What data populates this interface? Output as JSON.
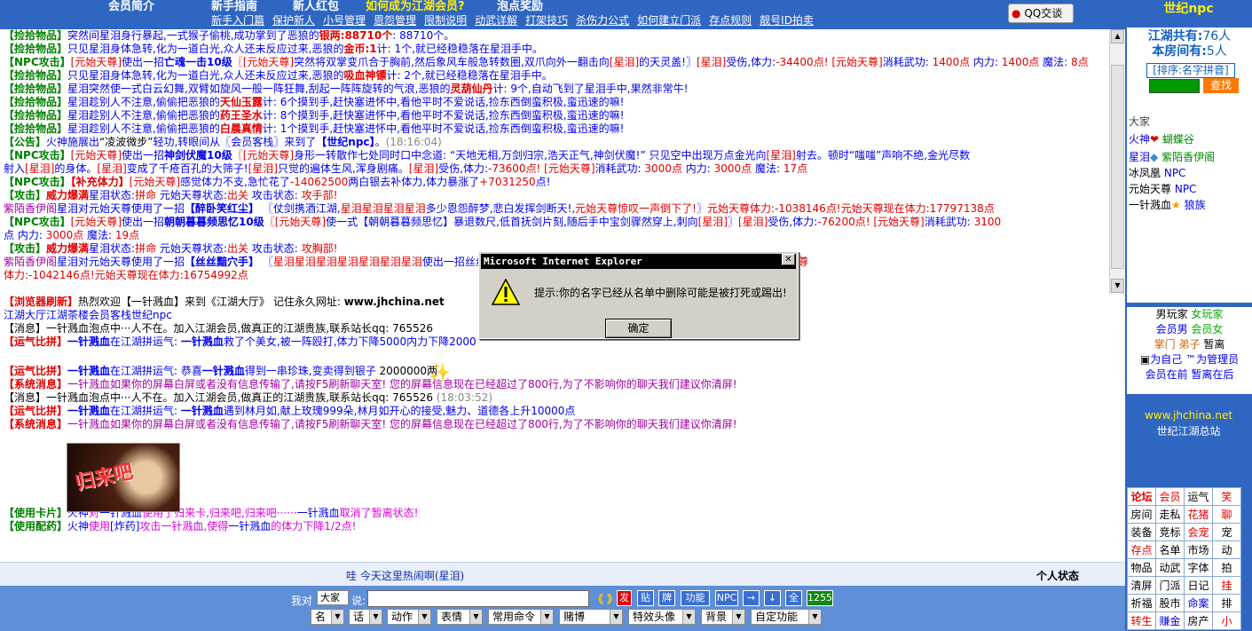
{
  "topnav": {
    "row1": [
      "会员简介",
      "新手指南",
      "新人红包",
      "如何成为江湖会员?",
      "泡点奖励"
    ],
    "row2": [
      "新手入门篇",
      "保护新人",
      "小号管理",
      "恩怨管理",
      "限制说明",
      "动武详解",
      "打架技巧",
      "杀伤力公式",
      "如何建立门派",
      "存点规则",
      "靓号ID拍卖"
    ],
    "qq": "QQ交谈"
  },
  "chat1": [
    [
      [
        "g",
        "【捡拾物品】"
      ],
      [
        "b",
        "突然间星泪身行暴起,一式猴子偷桃,成功掌到了恶狼的"
      ],
      [
        "rb",
        "银两:88710个"
      ],
      [
        "b",
        ": 88710个。"
      ]
    ],
    [
      [
        "g",
        "【捡拾物品】"
      ],
      [
        "b",
        "只见星泪身体急转,化为一道白光,众人还未反应过来,恶狼的"
      ],
      [
        "rb",
        "金币:1"
      ],
      [
        "b",
        "计: 1个,就已经稳稳落在星泪手中。"
      ]
    ],
    [
      [
        "g",
        "【NPC攻击】"
      ],
      [
        "r",
        "[元始天尊]"
      ],
      [
        "b",
        "使出一招"
      ],
      [
        "bb",
        "亡魂一击10级"
      ],
      [
        "r",
        "〖[元始天尊]"
      ],
      [
        "b",
        "突然将双掌变爪合于胸前,然后象风车般急转数圈,双爪向外一翻击向"
      ],
      [
        "r",
        "[星泪]"
      ],
      [
        "b",
        "的天灵盖!〗"
      ],
      [
        "r",
        "[星泪]"
      ],
      [
        "b",
        "受伤,体力:"
      ],
      [
        "r",
        "-34400点!"
      ],
      [
        "r",
        " [元始天尊]"
      ],
      [
        "b",
        "消耗武功: "
      ],
      [
        "r",
        "1400点"
      ],
      [
        "b",
        " 内力: "
      ],
      [
        "r",
        "1400点"
      ],
      [
        "b",
        " 魔法: "
      ],
      [
        "r",
        "8点"
      ]
    ],
    [
      [
        "g",
        "【捡拾物品】"
      ],
      [
        "b",
        "只见星泪身体急转,化为一道白光,众人还未反应过来,恶狼的"
      ],
      [
        "rb",
        "吸血神镖"
      ],
      [
        "b",
        "计: 2个,就已经稳稳落在星泪手中。"
      ]
    ],
    [
      [
        "g",
        "【捡拾物品】"
      ],
      [
        "b",
        "星泪突然使一式白云幻舞,双臂如旋风一般一阵狂舞,刮起一阵阵旋转的气浪,恶狼的"
      ],
      [
        "rb",
        "灵葫仙丹"
      ],
      [
        "b",
        "计: 9个,自动飞到了星泪手中,果然非常牛!"
      ]
    ],
    [
      [
        "g",
        "【捡拾物品】"
      ],
      [
        "b",
        "星泪趁别人不注意,偷偷把恶狼的"
      ],
      [
        "rb",
        "天仙玉露"
      ],
      [
        "b",
        "计: 6个摸到手,赶快塞进怀中,看他平时不爱说话,捡东西倒蛮积极,蛮迅速的嘛!"
      ]
    ],
    [
      [
        "g",
        "【捡拾物品】"
      ],
      [
        "b",
        "星泪趁别人不注意,偷偷把恶狼的"
      ],
      [
        "rb",
        "药王圣水"
      ],
      [
        "b",
        "计: 8个摸到手,赶快塞进怀中,看他平时不爱说话,捡东西倒蛮积极,蛮迅速的嘛!"
      ]
    ],
    [
      [
        "g",
        "【捡拾物品】"
      ],
      [
        "b",
        "星泪趁别人不注意,偷偷把恶狼的"
      ],
      [
        "rb",
        "白晨真情"
      ],
      [
        "b",
        "计: 1个摸到手,赶快塞进怀中,看他平时不爱说话,捡东西倒蛮积极,蛮迅速的嘛!"
      ]
    ],
    [
      [
        "g",
        "【公告】"
      ],
      [
        "b",
        "火神施展出"
      ],
      [
        "blk",
        "“凌波微步”"
      ],
      [
        "b",
        "轻功,转眼间从〖会员客栈〗来到了"
      ],
      [
        "bb",
        "【世纪npc】"
      ],
      [
        "b",
        "。"
      ],
      [
        "gy",
        "(18:16:04)"
      ]
    ],
    [
      [
        "g",
        "【NPC攻击】"
      ],
      [
        "r",
        "[元始天尊]"
      ],
      [
        "b",
        "使出一招"
      ],
      [
        "bb",
        "神剑伏魔10级"
      ],
      [
        "r",
        "〖[元始天尊]"
      ],
      [
        "b",
        "身形一转散作七处同时口中念道: “天地无相,万剑归宗,浩天正气,神剑伏魔!” 只见空中出现万点金光向"
      ],
      [
        "r",
        "[星泪]"
      ],
      [
        "b",
        "射去。顿时“嗤嗤”声响不绝,金光尽数"
      ]
    ],
    [
      [
        "b",
        "射入"
      ],
      [
        "r",
        "[星泪]"
      ],
      [
        "b",
        "的身体。"
      ],
      [
        "r",
        "[星泪]"
      ],
      [
        "b",
        "变成了千疮百孔的大筛子!"
      ],
      [
        "r",
        "[星泪]"
      ],
      [
        "b",
        "只觉的遍体生风,浑身剧痛。"
      ],
      [
        "r",
        "[星泪]"
      ],
      [
        "b",
        "受伤,体力:"
      ],
      [
        "r",
        "-73600点!"
      ],
      [
        "r",
        " [元始天尊]"
      ],
      [
        "b",
        "消耗武功: "
      ],
      [
        "r",
        "3000点"
      ],
      [
        "b",
        " 内力: "
      ],
      [
        "r",
        "3000点"
      ],
      [
        "b",
        " 魔法: "
      ],
      [
        "r",
        "17点"
      ]
    ],
    [
      [
        "g",
        "【NPC攻击】"
      ],
      [
        "rb",
        "【补充体力】"
      ],
      [
        "r",
        "[元始天尊]"
      ],
      [
        "b",
        "感觉体力不支,急忙花了"
      ],
      [
        "r",
        "-14062500"
      ],
      [
        "b",
        "两白银去补体力,体力暴涨了"
      ],
      [
        "r",
        "+7031250"
      ],
      [
        "b",
        "点!"
      ]
    ],
    [
      [
        "g",
        "【攻击】"
      ],
      [
        "rb",
        "威力爆满"
      ],
      [
        "b",
        "星泪状态:"
      ],
      [
        "r",
        "拼命"
      ],
      [
        "b",
        " 元始天尊状态:"
      ],
      [
        "r",
        "出关"
      ],
      [
        "b",
        " 攻击状态: "
      ],
      [
        "r",
        "攻手部!"
      ]
    ],
    [
      [
        "p",
        "紫陌香伊阁"
      ],
      [
        "b",
        "星泪对元始天尊使用了一招"
      ],
      [
        "bb",
        "【醉卧笑红尘】"
      ],
      [
        "b",
        " 〖仗剑携酒江湖,"
      ],
      [
        "r",
        "星泪星泪星泪星泪"
      ],
      [
        "b",
        "多少恩怨醉梦,悲白发挥剑断天!,"
      ],
      [
        "r",
        "元始天尊惊叹一声倒下了!"
      ],
      [
        "b",
        "〗"
      ],
      [
        "r",
        "元始天尊体力:-1038146点!元始天尊现在体力:17797138点"
      ]
    ],
    [
      [
        "g",
        "【NPC攻击】"
      ],
      [
        "r",
        "[元始天尊]"
      ],
      [
        "b",
        "使出一招"
      ],
      [
        "bb",
        "朝朝暮暮频思忆10级"
      ],
      [
        "r",
        "〖[元始天尊]"
      ],
      [
        "b",
        "使一式【朝朝暮暮频思忆】暴退数尺,低首抚剑片刻,随后手中宝剑骤然穿上,刺向"
      ],
      [
        "r",
        "[星泪]"
      ],
      [
        "b",
        "〗"
      ],
      [
        "r",
        "[星泪]"
      ],
      [
        "b",
        "受伤,体力:"
      ],
      [
        "r",
        "-76200点!"
      ],
      [
        "r",
        " [元始天尊]"
      ],
      [
        "b",
        "消耗武功: "
      ],
      [
        "r",
        "3100"
      ]
    ],
    [
      [
        "b",
        "点 内力: "
      ],
      [
        "r",
        "3000点"
      ],
      [
        "b",
        " 魔法: "
      ],
      [
        "r",
        "19点"
      ]
    ],
    [
      [
        "g",
        "【攻击】"
      ],
      [
        "rb",
        "威力爆满"
      ],
      [
        "b",
        "星泪状态:"
      ],
      [
        "r",
        "拼命"
      ],
      [
        "b",
        " 元始天尊状态:"
      ],
      [
        "r",
        "出关"
      ],
      [
        "b",
        " 攻击状态: "
      ],
      [
        "r",
        "攻胸部!"
      ]
    ],
    [
      [
        "p",
        "紫陌香伊阁"
      ],
      [
        "b",
        "星泪对元始天尊使用了一招"
      ],
      [
        "bb",
        "【丝丝黯穴手】"
      ],
      [
        "b",
        " 〖"
      ],
      [
        "r",
        "星泪星泪星泪星泪星泪星泪星泪"
      ],
      [
        "b",
        "使出一招丝丝黯穴手"
      ],
      [
        "b",
        " ······ "
      ],
      [
        "b",
        "一眼望去,"
      ],
      [
        "r",
        "元始天尊"
      ],
      [
        "b",
        "的鼻子里已经插满了大葱!〗"
      ],
      [
        "r",
        "元始天尊"
      ]
    ],
    [
      [
        "r",
        "体力:-1042146点!元始天尊现在体力:16754992点"
      ]
    ]
  ],
  "chat2": [
    [
      [
        "rb",
        "【浏览器刷新】"
      ],
      [
        "blk",
        "热烈欢迎【一针溅血】来到《江湖大厅》 记住永久网址: "
      ],
      [
        "bk",
        "www.jhchina.net"
      ]
    ],
    [
      [
        "b",
        "江湖大厅"
      ],
      [
        "b",
        "江湖茶楼"
      ],
      [
        "b",
        "会员客栈"
      ],
      [
        "b",
        "世纪npc"
      ]
    ],
    [
      [
        "blk",
        "【消息】一针溅血泡点中···人不在。加入江湖会员,做真正的江湖贵族,联系站长qq: 765526"
      ]
    ],
    [
      [
        "rb",
        "【运气比拼】"
      ],
      [
        "bb",
        "一针溅血"
      ],
      [
        "b",
        "在江湖拼运气: "
      ],
      [
        "bb",
        "一针溅血"
      ],
      [
        "b",
        "救了个美女,被一阵殴打,体力下降5000"
      ],
      [
        "b",
        "内力下降2000"
      ]
    ],
    [
      [
        "rb",
        "【运气比拼】"
      ],
      [
        "bb",
        "一针溅血"
      ],
      [
        "b",
        "在江湖拼运气: 恭喜"
      ],
      [
        "bb",
        "一针溅血"
      ],
      [
        "b",
        "得到一串珍珠,变卖得到银子"
      ],
      [
        "blk",
        " 2000000两"
      ]
    ],
    [
      [
        "rb",
        "【系统消息】"
      ],
      [
        "p",
        "一针溅血如果你的屏幕白屏或者没有信息传输了,请按F5刷新聊天室! 您的屏幕信息现在已经超过了800行,为了不影响你的聊天我们建议你清屏!"
      ]
    ],
    [
      [
        "blk",
        "【消息】一针溅血泡点中···人不在。加入江湖会员,做真正的江湖贵族,联系站长qq: 765526"
      ],
      [
        "gy",
        " (18:03:52)"
      ]
    ],
    [
      [
        "rb",
        "【运气比拼】"
      ],
      [
        "bb",
        "一针溅血"
      ],
      [
        "b",
        "在江湖拼运气: "
      ],
      [
        "bb",
        "一针溅血"
      ],
      [
        "b",
        "遇到林月如,献上玫瑰999朵,林月如开心的接受,魅力、道德各上升10000点"
      ]
    ],
    [
      [
        "rb",
        "【系统消息】"
      ],
      [
        "p",
        "一针溅血如果你的屏幕白屏或者没有信息传输了,请按F5刷新聊天室! 您的屏幕信息现在已经超过了800行,为了不影响你的聊天我们建议你清屏!"
      ]
    ],
    [
      [
        "g",
        "【使用卡片】"
      ],
      [
        "b",
        "火神"
      ],
      [
        "mg",
        "对"
      ],
      [
        "b",
        "一针溅血"
      ],
      [
        "mg",
        "使用了归来卡,归来吧,归来吧······"
      ],
      [
        "b",
        "一针溅血"
      ],
      [
        "mg",
        "取消了暂离状态!"
      ]
    ],
    [
      [
        "g",
        "【使用配药】"
      ],
      [
        "b",
        "火神"
      ],
      [
        "mg",
        "使用"
      ],
      [
        "b",
        "[炸药]"
      ],
      [
        "mg",
        "攻击一针溅血,使得"
      ],
      [
        "b",
        "一针溅血"
      ],
      [
        "mg",
        "的体力下降1/2点!"
      ]
    ]
  ],
  "card": {
    "caption": "归来吧"
  },
  "statusbar": {
    "text": "哇 今天这里热闹啊(星泪)",
    "personal": "个人状态"
  },
  "cmdbar": {
    "to_label": "我对",
    "to_value": "大家",
    "say_label": "说:",
    "arrows": "《 》",
    "buttons": [
      "发",
      "贴",
      "牌",
      "功能",
      "NPC",
      "→",
      "↓",
      "全",
      "1255"
    ],
    "selects": [
      "名",
      "话",
      "动作",
      "表情",
      "常用命令",
      "赌博",
      "特效头像",
      "背景",
      "自定功能"
    ]
  },
  "right": {
    "title": "世纪npc",
    "total_label": "江湖共有:",
    "total_value": "76人",
    "room_label": "本房间有:",
    "room_value": "5人",
    "sort_label": "[排序:名字拼音]",
    "search_btn": "查找",
    "category": "大家",
    "users": [
      {
        "name": "火神",
        "title": "蝴蝶谷"
      },
      {
        "name": "星泪",
        "title": "紫陌香伊阁"
      },
      {
        "name": "冰凤凰",
        "title": "NPC"
      },
      {
        "name": "元始天尊",
        "title": "NPC"
      },
      {
        "name": "一针溅血",
        "title": "狼族"
      }
    ],
    "legend": [
      "男玩家",
      "女玩家",
      "会员男",
      "会员女",
      "掌门",
      "弟子",
      "暂离",
      "为自己",
      "为管理员",
      "会员在前",
      "暂离在后"
    ],
    "site_url": "www.jhchina.net",
    "site_name": "世纪江湖总站",
    "grid": [
      [
        "论坛",
        "会员",
        "运气",
        "笑"
      ],
      [
        "房间",
        "走私",
        "花猪",
        "聊"
      ],
      [
        "装备",
        "竞标",
        "会宠",
        "宠"
      ],
      [
        "存点",
        "名单",
        "市场",
        "动"
      ],
      [
        "物品",
        "动武",
        "字体",
        "拍"
      ],
      [
        "清屏",
        "门派",
        "日记",
        "挂"
      ],
      [
        "祈福",
        "股市",
        "命案",
        "排"
      ],
      [
        "转生",
        "赚金",
        "房产",
        "小"
      ]
    ]
  },
  "dialog": {
    "title": "Microsoft Internet Explorer",
    "message": "提示:你的名字已经从名单中删除可能是被打死或踢出!",
    "ok": "确定"
  }
}
